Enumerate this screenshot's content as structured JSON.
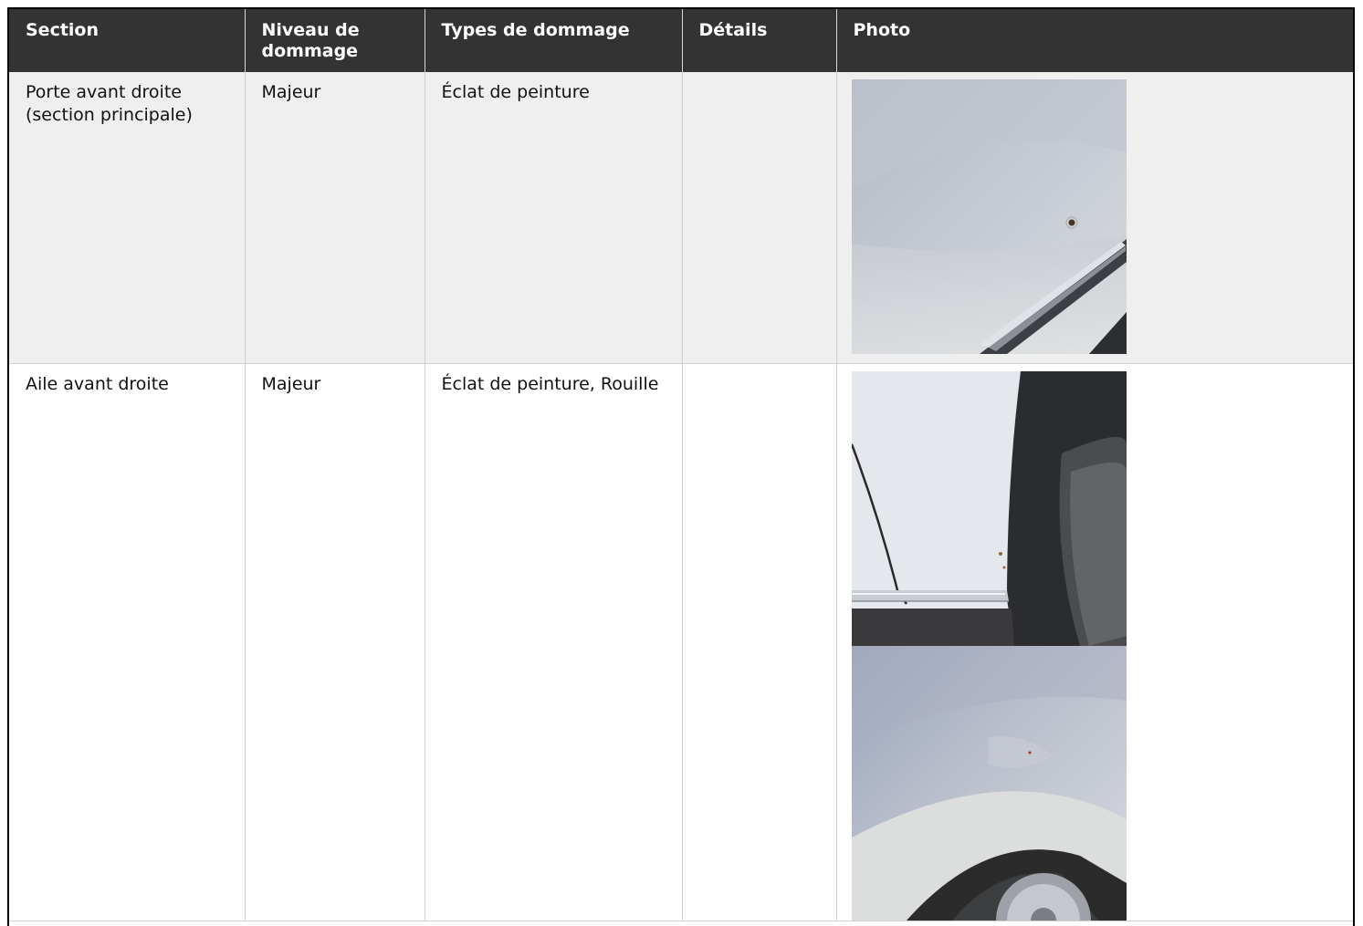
{
  "table": {
    "headers": [
      "Section",
      "Niveau de dommage",
      "Types de dommage",
      "Détails",
      "Photo"
    ],
    "rows": [
      {
        "section": "Porte avant droite (section principale)",
        "niveau": "Majeur",
        "types": "Éclat de peinture",
        "details": "",
        "photos": [
          "door-paint-chip-photo"
        ]
      },
      {
        "section": "Aile avant droite",
        "niveau": "Majeur",
        "types": "Éclat de peinture, Rouille",
        "details": "",
        "photos": [
          "fender-wheel-arch-photo",
          "fender-side-photo"
        ]
      }
    ]
  },
  "colors": {
    "header_bg": "#333333",
    "header_text": "#ffffff",
    "row_alt_bg": "#efefef",
    "border": "#d0d0d0"
  }
}
